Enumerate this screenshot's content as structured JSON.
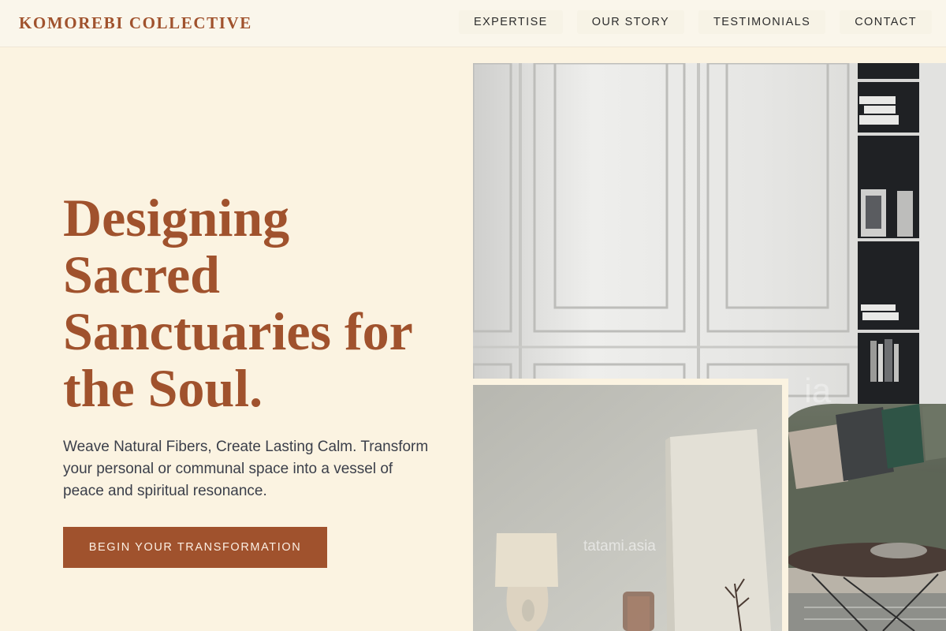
{
  "header": {
    "brand": "KOMOREBI COLLECTIVE",
    "nav": [
      {
        "label": "EXPERTISE"
      },
      {
        "label": "OUR STORY"
      },
      {
        "label": "TESTIMONIALS"
      },
      {
        "label": "CONTACT"
      }
    ]
  },
  "hero": {
    "title": "Designing Sacred Sanctuaries for the Soul.",
    "subtitle": "Weave Natural Fibers, Create Lasting Calm. Transform your personal or communal space into a vessel of peace and spiritual resonance.",
    "cta_label": "BEGIN YOUR TRANSFORMATION"
  },
  "images": {
    "watermark": "tatami.asia"
  },
  "colors": {
    "accent": "#A0522D",
    "background": "#FBF3E1",
    "header_bg": "#FAF6EB"
  }
}
